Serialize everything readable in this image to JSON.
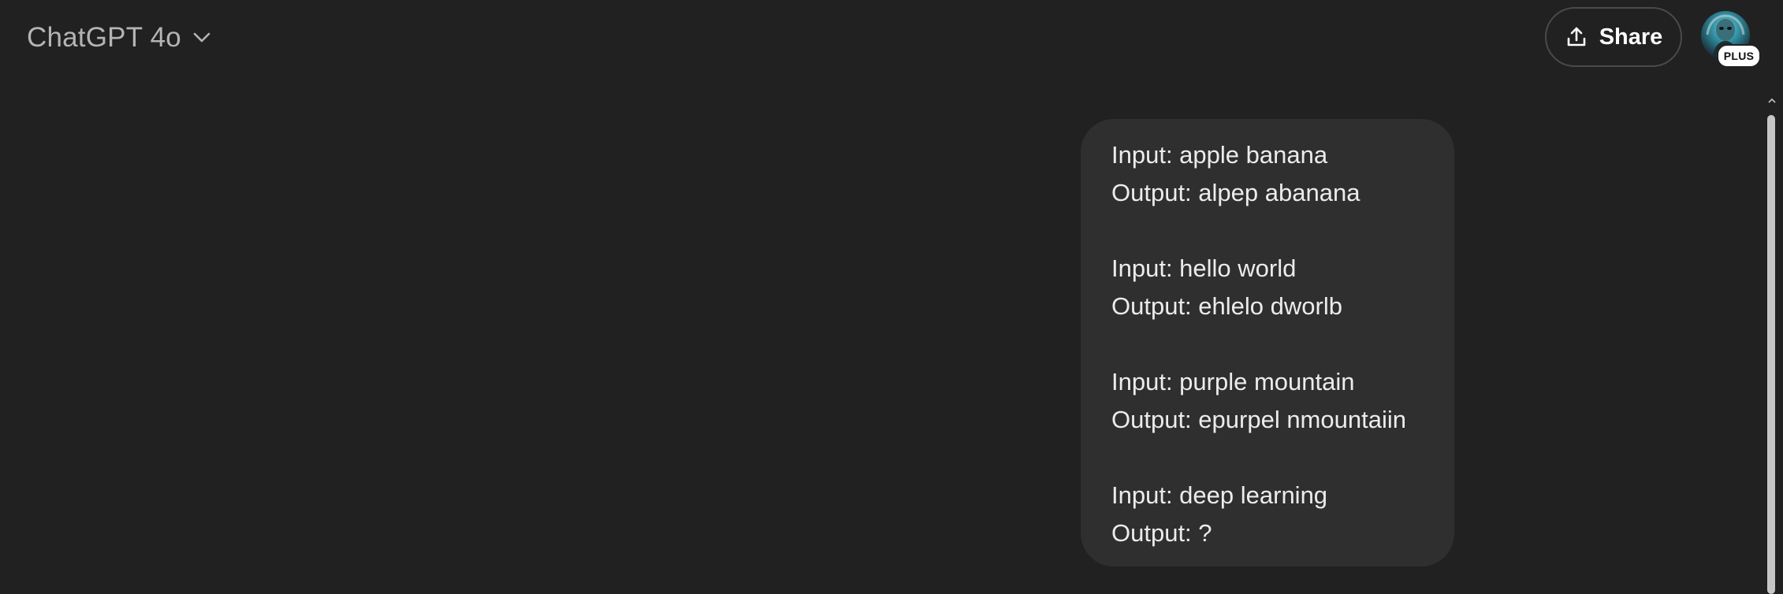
{
  "header": {
    "model_name": "ChatGPT 4o",
    "model_dropdown_icon": "chevron-down-icon",
    "share_label": "Share",
    "share_icon": "share-upload-icon",
    "avatar_badge": "PLUS"
  },
  "message": {
    "lines": [
      "Input: apple banana",
      "Output: alpep abanana",
      "",
      "Input: hello world",
      "Output: ehlelo dworlb",
      "",
      "Input: purple mountain",
      "Output: epurpel nmountaiin",
      "",
      "Input: deep learning",
      "Output: ?"
    ]
  },
  "colors": {
    "background": "#212121",
    "bubble": "#2f2f2f",
    "text": "#ececec",
    "muted_text": "#b4b4b4"
  }
}
